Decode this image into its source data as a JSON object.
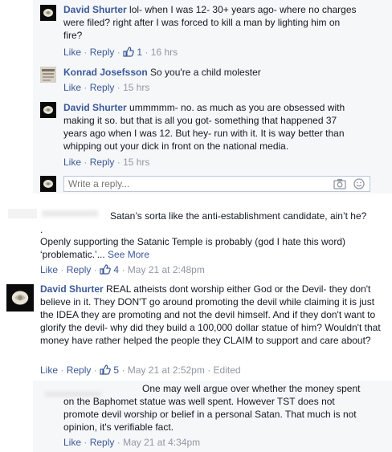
{
  "replies": [
    {
      "author": "David Shurter",
      "text": "lol- when I was 12- 30+ years ago- where no charges were filed? right after I was forced to kill a man by lighting him on fire?",
      "like": "Like",
      "reply": "Reply",
      "likes": "1",
      "time": "16 hrs"
    },
    {
      "author": "Konrad Josefsson",
      "text": "So you're a child molester",
      "like": "Like",
      "reply": "Reply",
      "time": "15 hrs"
    },
    {
      "author": "David Shurter",
      "text": "ummmmm- no. as much as you are obsessed with making it so. but that is all you got- something that happened 37 years ago when I was 12. But hey- run with it. It is way better than whipping out your dick in front on the national media.",
      "like": "Like",
      "reply": "Reply",
      "time": "15 hrs"
    }
  ],
  "reply_input": {
    "placeholder": "Write a reply..."
  },
  "comments": [
    {
      "text1": "Satan’s sorta like the anti-establishment candidate, ain’t he?",
      "text2": ".",
      "text3": "Openly supporting the Satanic Temple is probably (god I hate this word) ‘problematic.’...",
      "see_more": "See More",
      "like": "Like",
      "reply": "Reply",
      "likes": "4",
      "time": "May 21 at 2:48pm"
    },
    {
      "author": "David Shurter",
      "text": "REAL atheists dont worship either God or the Devil- they don't believe in it. They DON'T go around promoting the devil while claiming it is just the IDEA they are promoting and not the devil himself. And if they don't want to glorify the devil- why did they build a 100,000 dollar statue of him? Wouldn't that money have rather helped the people they CLAIM to support and care about?",
      "like": "Like",
      "reply": "Reply",
      "likes": "5",
      "time": "May 21 at 2:52pm",
      "edited": "Edited"
    },
    {
      "text": "One may well argue over whether the money spent on the Baphomet statue was well spent. However TST does not promote devil worship or belief in a personal Satan. That much is not opinion, it's verifiable fact.",
      "like": "Like",
      "reply": "Reply",
      "time": "May 21 at 4:34pm"
    }
  ],
  "colors": {
    "link": "#3b5998",
    "meta": "#9197a3",
    "reply_bg": "#f6f7f9"
  },
  "icons": [
    "rose-avatar",
    "thumbs-up-icon",
    "camera-icon",
    "smiley-icon"
  ]
}
